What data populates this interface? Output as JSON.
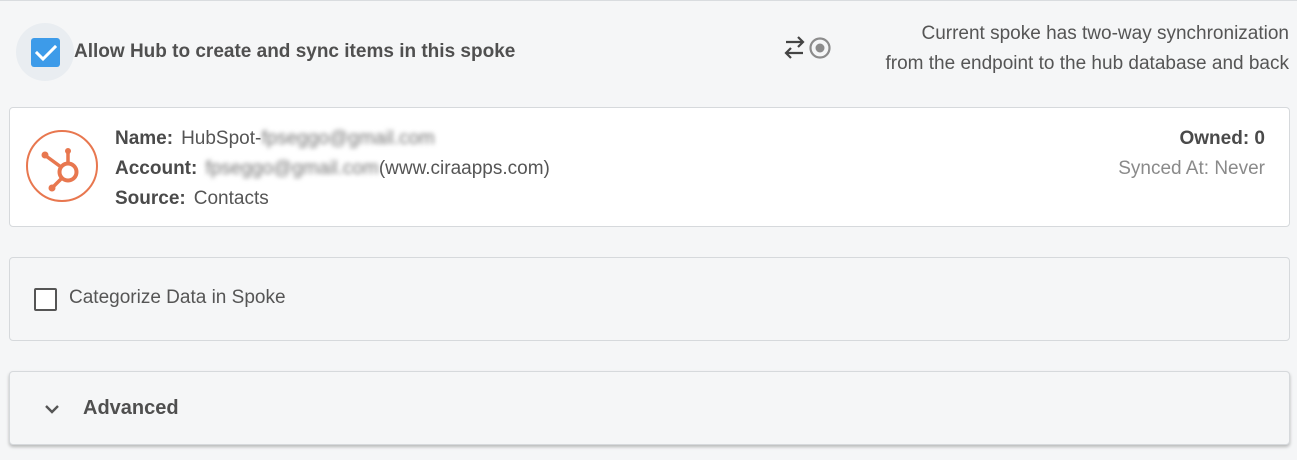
{
  "allow_sync": {
    "checked": true,
    "label": "Allow Hub to create and sync items in this spoke"
  },
  "sync_mode": {
    "icon": "two-way-sync-icon",
    "line1": "Current spoke has two-way synchronization",
    "line2": "from the endpoint to the hub database and back"
  },
  "account_card": {
    "logo": "hubspot-logo",
    "name_label": "Name:",
    "name_prefix": "HubSpot-",
    "name_blurred": "fpseggo@gmail.com",
    "account_label": "Account:",
    "account_blurred": "fpseggo@gmail.com",
    "account_suffix": "(www.ciraapps.com)",
    "source_label": "Source:",
    "source_value": "Contacts",
    "owned": "Owned: 0",
    "synced_at": "Synced At: Never"
  },
  "categorize": {
    "checked": false,
    "label": "Categorize Data in Spoke"
  },
  "advanced": {
    "label": "Advanced",
    "expanded": false
  },
  "colors": {
    "checkbox_accent": "#3d9be9",
    "hubspot_orange": "#e8774f"
  }
}
